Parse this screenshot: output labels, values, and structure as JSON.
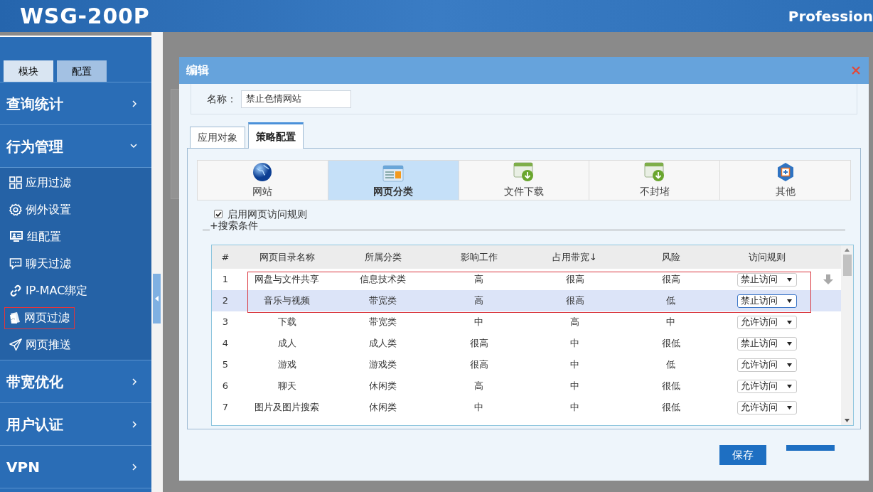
{
  "header": {
    "title": "WSG-200P",
    "subtitle": "Profession"
  },
  "sidebar": {
    "tabs": [
      {
        "label": "模块",
        "selected": false
      },
      {
        "label": "配置",
        "selected": true
      }
    ],
    "menu": [
      {
        "label": "查询统计",
        "expanded": false
      },
      {
        "label": "行为管理",
        "expanded": true,
        "children": [
          {
            "label": "应用过滤",
            "outlined": false
          },
          {
            "label": "例外设置",
            "outlined": false
          },
          {
            "label": "组配置",
            "outlined": false
          },
          {
            "label": "聊天过滤",
            "outlined": false
          },
          {
            "label": "IP-MAC绑定",
            "outlined": false
          },
          {
            "label": "网页过滤",
            "outlined": true
          },
          {
            "label": "网页推送",
            "outlined": false
          }
        ]
      },
      {
        "label": "带宽优化",
        "expanded": false
      },
      {
        "label": "用户认证",
        "expanded": false
      },
      {
        "label": "VPN",
        "expanded": false
      }
    ]
  },
  "dialog": {
    "title": "编辑",
    "name_label": "名称：",
    "name_value": "禁止色情网站",
    "tabs": [
      {
        "label": "应用对象",
        "selected": false
      },
      {
        "label": "策略配置",
        "selected": true
      }
    ],
    "categories": [
      {
        "label": "网站",
        "selected": false
      },
      {
        "label": "网页分类",
        "selected": true
      },
      {
        "label": "文件下载",
        "selected": false
      },
      {
        "label": "不封堵",
        "selected": false
      },
      {
        "label": "其他",
        "selected": false
      }
    ],
    "enable_rule": {
      "label": "启用网页访问规则",
      "checked": true
    },
    "search_legend": "+搜索条件",
    "table": {
      "columns": [
        "#",
        "网页目录名称",
        "所属分类",
        "影响工作",
        "占用带宽↓",
        "风险",
        "访问规则"
      ],
      "rows": [
        {
          "cells": [
            "1",
            "网盘与文件共享",
            "信息技术类",
            "高",
            "很高",
            "很高"
          ],
          "rule": "禁止访问",
          "selected": false,
          "outlined": true
        },
        {
          "cells": [
            "2",
            "音乐与视频",
            "带宽类",
            "高",
            "很高",
            "低"
          ],
          "rule": "禁止访问",
          "selected": true,
          "outlined": true
        },
        {
          "cells": [
            "3",
            "下载",
            "带宽类",
            "中",
            "高",
            "中"
          ],
          "rule": "允许访问",
          "selected": false,
          "outlined": false
        },
        {
          "cells": [
            "4",
            "成人",
            "成人类",
            "很高",
            "中",
            "很低"
          ],
          "rule": "禁止访问",
          "selected": false,
          "outlined": false
        },
        {
          "cells": [
            "5",
            "游戏",
            "游戏类",
            "很高",
            "中",
            "低"
          ],
          "rule": "允许访问",
          "selected": false,
          "outlined": false
        },
        {
          "cells": [
            "6",
            "聊天",
            "休闲类",
            "高",
            "中",
            "很低"
          ],
          "rule": "允许访问",
          "selected": false,
          "outlined": false
        },
        {
          "cells": [
            "7",
            "图片及图片搜索",
            "休闲类",
            "中",
            "中",
            "很低"
          ],
          "rule": "允许访问",
          "selected": false,
          "outlined": false
        }
      ]
    },
    "buttons": [
      {
        "label": "保存"
      }
    ]
  }
}
